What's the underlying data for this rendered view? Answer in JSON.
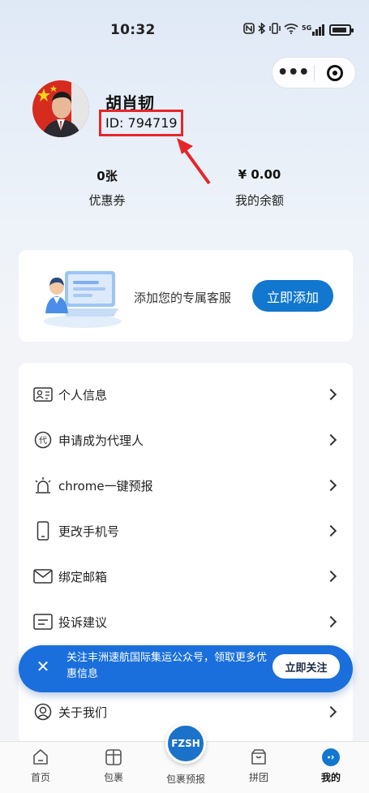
{
  "status_bar": {
    "time": "10:32",
    "icons": [
      "nfc-icon",
      "bluetooth-icon",
      "vibrate-icon",
      "wifi-icon",
      "signal-icon",
      "battery-icon"
    ],
    "network": "5G"
  },
  "profile": {
    "name": "胡肖韧",
    "id_text": "ID: 794719",
    "highlight_color": "#e6262b"
  },
  "stats": {
    "coupons": {
      "value": "0张",
      "label": "优惠券"
    },
    "balance": {
      "value": "¥ 0.00",
      "label": "我的余额"
    }
  },
  "service_card": {
    "text": "添加您的专属客服",
    "button_label": "立即添加"
  },
  "menu": [
    {
      "label": "个人信息",
      "icon": "id-card-icon"
    },
    {
      "label": "申请成为代理人",
      "icon": "agent-icon"
    },
    {
      "label": "chrome一键预报",
      "icon": "alarm-light-icon"
    },
    {
      "label": "更改手机号",
      "icon": "phone-icon"
    },
    {
      "label": "绑定邮箱",
      "icon": "mail-icon"
    },
    {
      "label": "投诉建议",
      "icon": "feedback-icon"
    },
    {
      "label": "关于我们",
      "icon": "user-circle-icon"
    }
  ],
  "follow_banner": {
    "text": "关注丰洲速航国际集运公众号，领取更多优惠信息",
    "button_label": "立即关注"
  },
  "tabs": [
    {
      "label": "首页",
      "icon": "home-icon"
    },
    {
      "label": "包裹",
      "icon": "package-icon"
    },
    {
      "label": "包裹预报",
      "icon": "fzsh-logo"
    },
    {
      "label": "拼团",
      "icon": "group-buy-icon"
    },
    {
      "label": "我的",
      "icon": "profile-icon",
      "active": true
    }
  ],
  "center_logo_text": "FZSH",
  "accent_color": "#1177cf"
}
